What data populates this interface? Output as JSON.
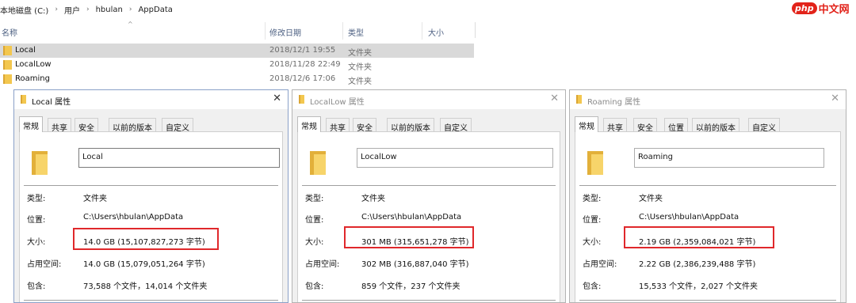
{
  "explorer": {
    "breadcrumb": [
      "本地磁盘 (C:)",
      "用户",
      "hbulan",
      "AppData"
    ],
    "breadcrumb_sep": "›",
    "columns": {
      "name": "名称",
      "modified": "修改日期",
      "type": "类型",
      "size": "大小"
    },
    "rows": [
      {
        "name": "Local",
        "date": "2018/12/1 19:55",
        "type": "文件夹",
        "selected": true
      },
      {
        "name": "LocalLow",
        "date": "2018/11/28 22:49",
        "type": "文件夹",
        "selected": false
      },
      {
        "name": "Roaming",
        "date": "2018/12/6 17:06",
        "type": "文件夹",
        "selected": false
      }
    ]
  },
  "watermark": {
    "logo": "php",
    "text": "中文网"
  },
  "labels": {
    "type": "类型:",
    "location": "位置:",
    "size": "大小:",
    "size_on_disk": "占用空间:",
    "contains": "包含:"
  },
  "close_glyph": "✕",
  "dialogs": [
    {
      "title": "Local 属性",
      "active": true,
      "tabs": [
        "常规",
        "共享",
        "安全",
        "以前的版本",
        "自定义"
      ],
      "name": "Local",
      "type": "文件夹",
      "location": "C:\\Users\\hbulan\\AppData",
      "size": "14.0 GB (15,107,827,273 字节)",
      "size_on_disk": "14.0 GB (15,079,051,264 字节)",
      "contains": "73,588 个文件，14,014 个文件夹"
    },
    {
      "title": "LocalLow 属性",
      "active": false,
      "tabs": [
        "常规",
        "共享",
        "安全",
        "以前的版本",
        "自定义"
      ],
      "name": "LocalLow",
      "type": "文件夹",
      "location": "C:\\Users\\hbulan\\AppData",
      "size": "301 MB (315,651,278 字节)",
      "size_on_disk": "302 MB (316,887,040 字节)",
      "contains": "859 个文件，237 个文件夹"
    },
    {
      "title": "Roaming 属性",
      "active": false,
      "tabs": [
        "常规",
        "共享",
        "安全",
        "位置",
        "以前的版本",
        "自定义"
      ],
      "name": "Roaming",
      "type": "文件夹",
      "location": "C:\\Users\\hbulan\\AppData",
      "size": "2.19 GB (2,359,084,021 字节)",
      "size_on_disk": "2.22 GB (2,386,239,488 字节)",
      "contains": "15,533 个文件，2,027 个文件夹"
    }
  ]
}
